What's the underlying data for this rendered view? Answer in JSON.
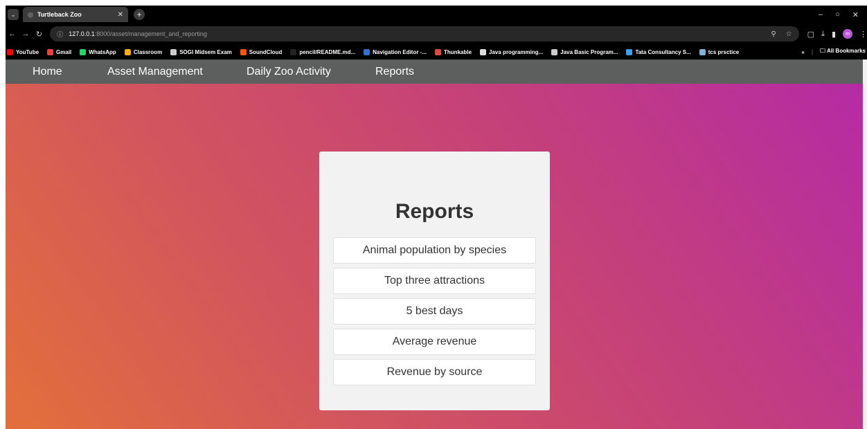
{
  "browser": {
    "tab": {
      "title": "Turtleback Zoo"
    },
    "url": {
      "host": "127.0.0.1",
      "path": ":8000/asset/management_and_reporting"
    },
    "bookmarks": [
      {
        "label": "YouTube",
        "icon_color": "#ff0000"
      },
      {
        "label": "Gmail",
        "icon_color": "#ea4335"
      },
      {
        "label": "WhatsApp",
        "icon_color": "#25d366"
      },
      {
        "label": "Classroom",
        "icon_color": "#f9ab00"
      },
      {
        "label": "SOGI Midsem Exam",
        "icon_color": "#cccccc"
      },
      {
        "label": "SoundCloud",
        "icon_color": "#ff5500"
      },
      {
        "label": "pencil/README.md...",
        "icon_color": "#222222"
      },
      {
        "label": "Navigation Editor -...",
        "icon_color": "#2f6fd6"
      },
      {
        "label": "Thunkable",
        "icon_color": "#e04a3a"
      },
      {
        "label": "Java programming...",
        "icon_color": "#dddddd"
      },
      {
        "label": "Java Basic Program...",
        "icon_color": "#cccccc"
      },
      {
        "label": "Tata Consultancy S...",
        "icon_color": "#3aa0e8"
      },
      {
        "label": "tcs prsctice",
        "icon_color": "#7fb3d5"
      }
    ],
    "all_bookmarks_label": "All Bookmarks",
    "profile_initial": "m"
  },
  "nav": {
    "home": "Home",
    "asset_management": "Asset Management",
    "daily_activity": "Daily Zoo Activity",
    "reports": "Reports"
  },
  "card": {
    "title": "Reports",
    "buttons": [
      "Animal population by species",
      "Top three attractions",
      "5 best days",
      "Average revenue",
      "Revenue by source"
    ]
  }
}
